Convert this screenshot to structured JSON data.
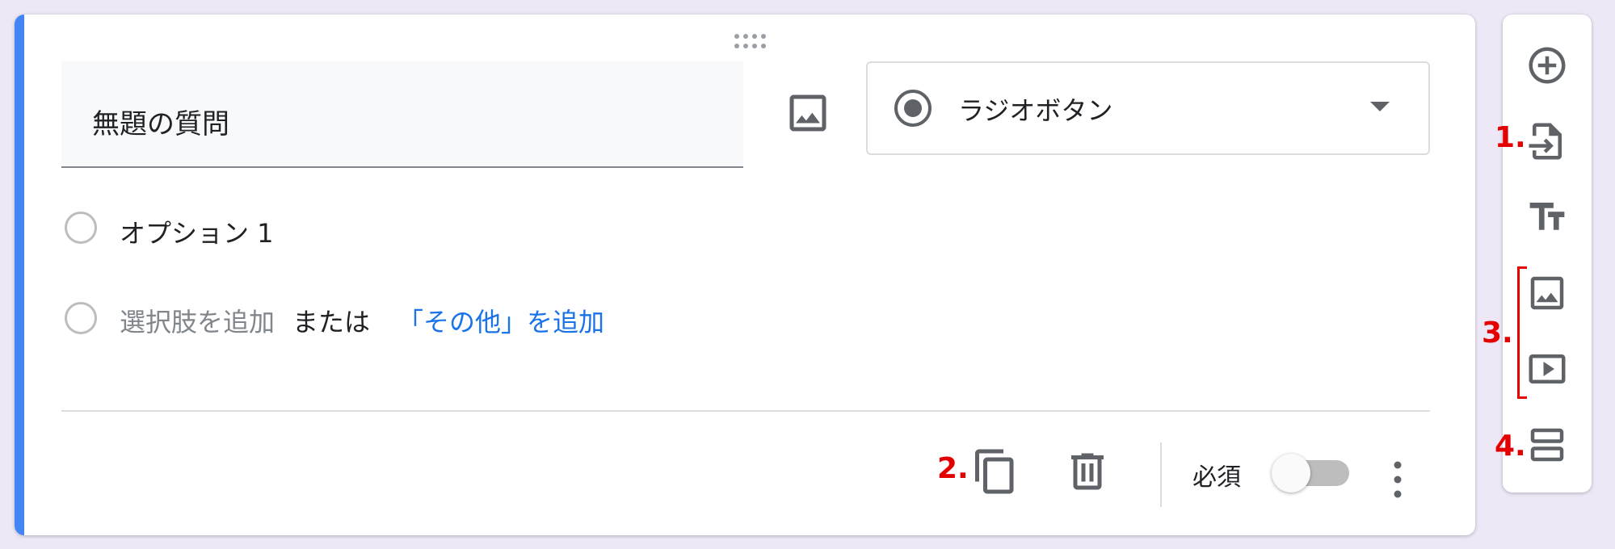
{
  "question": {
    "title": "無題の質問",
    "type_label": "ラジオボタン",
    "options": [
      {
        "label": "オプション 1"
      }
    ],
    "add_option_label": "選択肢を追加",
    "or_label": "または",
    "add_other_label": "「その他」を追加"
  },
  "footer": {
    "required_label": "必須",
    "required_enabled": false
  },
  "sidebar": {
    "items": [
      {
        "icon": "add-circle-icon"
      },
      {
        "icon": "import-question-icon"
      },
      {
        "icon": "title-text-icon"
      },
      {
        "icon": "image-icon"
      },
      {
        "icon": "video-icon"
      },
      {
        "icon": "section-icon"
      }
    ]
  },
  "annotations": {
    "one": "1.",
    "two": "2.",
    "three": "3.",
    "four": "4."
  },
  "colors": {
    "accent": "#4285f4",
    "link": "#1a73e8",
    "annotation": "#e50000",
    "background": "#ede7f6"
  }
}
